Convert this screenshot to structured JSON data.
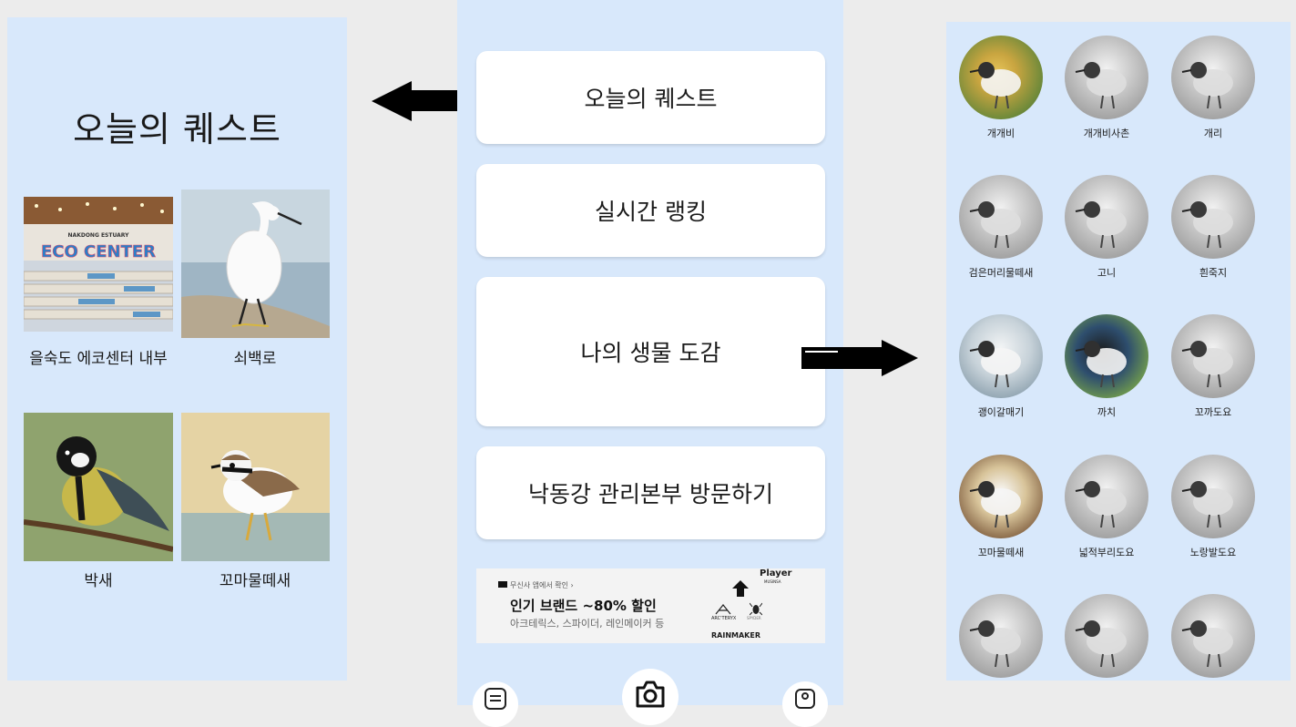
{
  "quest_panel": {
    "title": "오늘의 퀘스트",
    "items": [
      {
        "label": "을숙도 에코센터 내부",
        "sign_line1": "NAKDONG ESTUARY",
        "sign_line2": "ECO CENTER"
      },
      {
        "label": "쇠백로"
      },
      {
        "label": "박새"
      },
      {
        "label": "꼬마물떼새"
      }
    ]
  },
  "main_menu": {
    "buttons": [
      "오늘의 퀘스트",
      "실시간 랭킹",
      "나의 생물 도감",
      "낙동강 관리본부 방문하기"
    ]
  },
  "ad": {
    "small": "무신사 앱에서 확인 ›",
    "headline": "인기 브랜드 ~80% 할인",
    "sub": "아크테릭스, 스파이더, 레인메이커 등",
    "brand_player": "Player",
    "brand_musinsa": "MUSINSA",
    "brand_arc": "ARC'TERYX",
    "brand_spyder": "SPYDER",
    "brand_rain": "RAINMAKER"
  },
  "bottom_nav": {
    "icons": [
      "list-icon",
      "camera-icon",
      "profile-icon"
    ]
  },
  "bird_book": {
    "birds": [
      {
        "name": "개개비",
        "color": true
      },
      {
        "name": "개개비사촌",
        "color": false
      },
      {
        "name": "개리",
        "color": false
      },
      {
        "name": "검은머리물떼새",
        "color": false
      },
      {
        "name": "고니",
        "color": false
      },
      {
        "name": "흰죽지",
        "color": false
      },
      {
        "name": "괭이갈매기",
        "color": true
      },
      {
        "name": "까치",
        "color": true
      },
      {
        "name": "꼬까도요",
        "color": false
      },
      {
        "name": "꼬마물떼새",
        "color": true
      },
      {
        "name": "넓적부리도요",
        "color": false
      },
      {
        "name": "노랑발도요",
        "color": false
      },
      {
        "name": "",
        "color": false
      },
      {
        "name": "",
        "color": false
      },
      {
        "name": "",
        "color": false
      }
    ]
  },
  "colors": {
    "panel_bg": "#d8e8fb",
    "page_bg": "#ececec",
    "button_bg": "#ffffff"
  }
}
